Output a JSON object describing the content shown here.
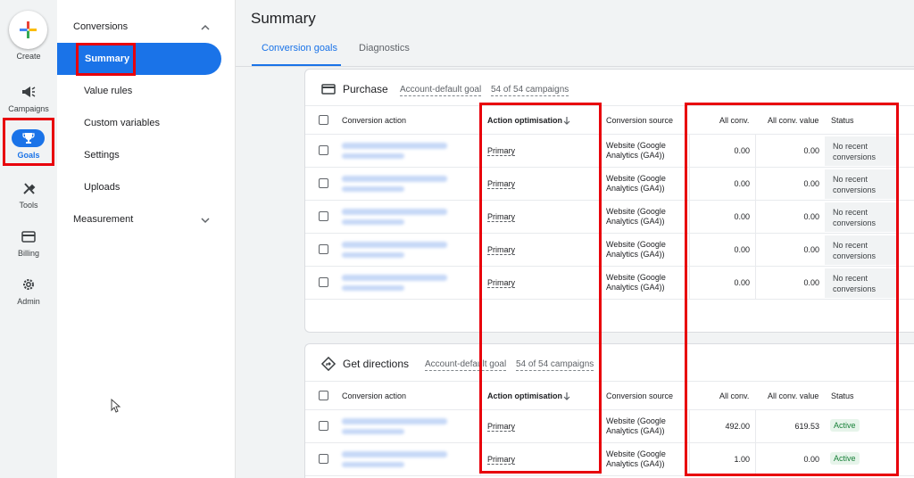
{
  "rail": {
    "create_label": "Create",
    "items": [
      {
        "label": "Campaigns",
        "icon": "megaphone-icon"
      },
      {
        "label": "Goals",
        "icon": "trophy-icon"
      },
      {
        "label": "Tools",
        "icon": "tools-icon"
      },
      {
        "label": "Billing",
        "icon": "credit-card-icon"
      },
      {
        "label": "Admin",
        "icon": "gear-icon"
      }
    ]
  },
  "subnav": {
    "conversions_label": "Conversions",
    "items": [
      "Summary",
      "Value rules",
      "Custom variables",
      "Settings",
      "Uploads"
    ],
    "measurement_label": "Measurement"
  },
  "page": {
    "title": "Summary",
    "tabs": [
      "Conversion goals",
      "Diagnostics"
    ]
  },
  "columns": {
    "action": "Conversion action",
    "optimisation": "Action optimisation",
    "source": "Conversion source",
    "all_conv": "All conv.",
    "all_value": "All conv. value",
    "status": "Status"
  },
  "purchase": {
    "title": "Purchase",
    "goal_type": "Account-default goal",
    "campaigns": "54 of 54 campaigns",
    "rows": [
      {
        "optimisation": "Primary",
        "source": "Website (Google Analytics (GA4))",
        "all_conv": "0.00",
        "all_value": "0.00",
        "status": "No recent conversions"
      },
      {
        "optimisation": "Primary",
        "source": "Website (Google Analytics (GA4))",
        "all_conv": "0.00",
        "all_value": "0.00",
        "status": "No recent conversions"
      },
      {
        "optimisation": "Primary",
        "source": "Website (Google Analytics (GA4))",
        "all_conv": "0.00",
        "all_value": "0.00",
        "status": "No recent conversions"
      },
      {
        "optimisation": "Primary",
        "source": "Website (Google Analytics (GA4))",
        "all_conv": "0.00",
        "all_value": "0.00",
        "status": "No recent conversions"
      },
      {
        "optimisation": "Primary",
        "source": "Website (Google Analytics (GA4))",
        "all_conv": "0.00",
        "all_value": "0.00",
        "status": "No recent conversions"
      }
    ]
  },
  "directions": {
    "title": "Get directions",
    "goal_type": "Account-default goal",
    "campaigns": "54 of 54 campaigns",
    "rows": [
      {
        "optimisation": "Primary",
        "source": "Website (Google Analytics (GA4))",
        "all_conv": "492.00",
        "all_value": "619.53",
        "status": "Active"
      },
      {
        "optimisation": "Primary",
        "source": "Website (Google Analytics (GA4))",
        "all_conv": "1.00",
        "all_value": "0.00",
        "status": "Active"
      }
    ]
  },
  "colors": {
    "accent": "#1a73e8",
    "highlight": "#e8000b",
    "active_status": "#188038"
  }
}
